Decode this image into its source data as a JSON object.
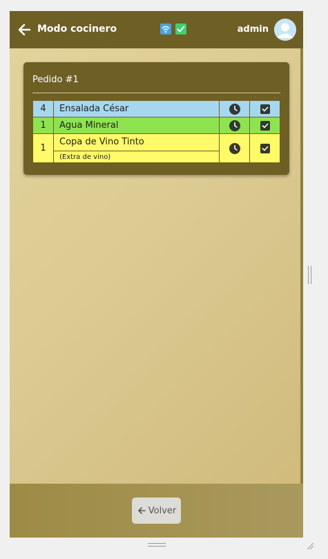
{
  "header": {
    "title": "Modo cocinero",
    "user_name": "admin",
    "icons": [
      "back-arrow-icon",
      "wifi-icon",
      "check-icon",
      "user-avatar-icon"
    ]
  },
  "order": {
    "title": "Pedido #1",
    "items": [
      {
        "qty": "4",
        "name": "Ensalada César",
        "note": "",
        "color": "#a5d8ee"
      },
      {
        "qty": "1",
        "name": "Agua Mineral",
        "note": "",
        "color": "#8ee44f"
      },
      {
        "qty": "1",
        "name": "Copa de Vino Tinto",
        "note": "(Extra de vino)",
        "color": "#fffa67"
      }
    ]
  },
  "footer": {
    "back_label": "Volver"
  },
  "colors": {
    "header_bg": "#6e5f25",
    "card_bg": "#6e5f25",
    "footer_bg": "#a9995d"
  }
}
